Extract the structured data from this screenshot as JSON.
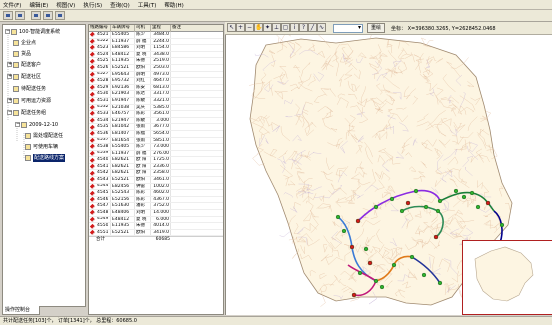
{
  "menu": [
    "文件(F)",
    "编辑(E)",
    "视图(V)",
    "执行(S)",
    "查询(Q)",
    "工具(T)",
    "帮助(H)"
  ],
  "map_toolbar": {
    "tool_icons": [
      "arrow-select-icon",
      "zoom-in-icon",
      "zoom-out-icon",
      "pan-icon",
      "identify-icon",
      "measure-icon",
      "select-icon",
      "info-icon",
      "query-icon",
      "line-tool-icon",
      "curve-tool-icon",
      "polygon-tool-icon"
    ],
    "layer_select_value": "",
    "reset_label": "重绘",
    "coords_label": "坐标： X=396380.3265, Y=2628452.0468"
  },
  "tree": {
    "items": [
      {
        "label": "100·智能调度系统",
        "level": 0
      },
      {
        "label": "企业点",
        "level": 1
      },
      {
        "label": "货品",
        "level": 1
      },
      {
        "label": "配送客户",
        "level": 1
      },
      {
        "label": "配送社区",
        "level": 1
      },
      {
        "label": "待配送任务",
        "level": 1
      },
      {
        "label": "可用运力资源",
        "level": 1
      },
      {
        "label": "配送任务组",
        "level": 1
      },
      {
        "label": "2009-12-10",
        "level": 2
      },
      {
        "label": "需处理配送任",
        "level": 3
      },
      {
        "label": "可使用车辆",
        "level": 3
      },
      {
        "label": "配送路线方案",
        "level": 3
      }
    ],
    "panel_tab": "操作控制台"
  },
  "grid": {
    "columns": [
      "线路编号",
      "车辆牌号",
      "司机",
      "里程",
      "备注"
    ],
    "rows": [
      [
        "4521",
        "E55405",
        "陈少",
        "3484.0",
        ""
      ],
      [
        "4522",
        "E11937",
        "薛 福",
        "2244.0",
        ""
      ],
      [
        "4523",
        "E84586",
        "刘明",
        "1154.0",
        ""
      ],
      [
        "4524",
        "E48412",
        "夏 晓",
        "3438.0",
        ""
      ],
      [
        "4525",
        "E11935",
        "朱德",
        "2519.0",
        ""
      ],
      [
        "4526",
        "E52521",
        "欧阳",
        "2503.0",
        ""
      ],
      [
        "4527",
        "E95643",
        "薛明",
        "4973.0",
        ""
      ],
      [
        "4528",
        "E95732",
        "刘红",
        "4647.0",
        ""
      ],
      [
        "4529",
        "E92136",
        "陈安",
        "6813.0",
        ""
      ],
      [
        "4530",
        "E21903",
        "陈达",
        "3317.0",
        ""
      ],
      [
        "4531",
        "E91947",
        "陈敏",
        "3321.0",
        ""
      ],
      [
        "4532",
        "E21038",
        "吴庆",
        "5385.0",
        ""
      ],
      [
        "4533",
        "E46757",
        "陈彩",
        "3561.0",
        ""
      ],
      [
        "4534",
        "E21947",
        "陈敏",
        "3.000",
        ""
      ],
      [
        "4535",
        "E81042",
        "张雨",
        "3677.0",
        ""
      ],
      [
        "4536",
        "E81407",
        "陈福",
        "5654.0",
        ""
      ],
      [
        "4537",
        "E81654",
        "张雨",
        "5851.0",
        ""
      ],
      [
        "4538",
        "E55405",
        "陈少",
        "73.000",
        ""
      ],
      [
        "4539",
        "E11937",
        "薛 福",
        "276.00",
        ""
      ],
      [
        "4540",
        "E82621",
        "欧 阳",
        "1725.0",
        ""
      ],
      [
        "4541",
        "E82621",
        "欧 阳",
        "2336.0",
        ""
      ],
      [
        "4542",
        "E82621",
        "欧 阳",
        "2358.0",
        ""
      ],
      [
        "4543",
        "E52521",
        "欧阳",
        "3461.0",
        ""
      ],
      [
        "4544",
        "E82456",
        "钟雷",
        "1002.0",
        ""
      ],
      [
        "4545",
        "E52543",
        "陈彩",
        "4602.0",
        ""
      ],
      [
        "4546",
        "E52156",
        "陈彩",
        "4367.0",
        ""
      ],
      [
        "4547",
        "E51630",
        "潘彩",
        "3752.0",
        ""
      ],
      [
        "4548",
        "E48406",
        "刘明",
        "14.000",
        ""
      ],
      [
        "4549",
        "E48412",
        "夏 晓",
        "6.000",
        ""
      ],
      [
        "4550",
        "E11935",
        "朱德",
        "4014.0",
        ""
      ],
      [
        "4551",
        "E52521",
        "欧阳",
        "3419.0",
        ""
      ]
    ],
    "total_label": "合计",
    "total_value": "60685"
  },
  "status": "共计配送任务[103]个， 订单[1341]个， 总里程：60685.0",
  "colors": {
    "window_bg": "#d4d0c8",
    "map_bg": "#fff8e8",
    "region_fill": "#fdf5e2",
    "road_color": "#e2bfa0",
    "selection_bg": "#0a246a",
    "node_red": "#d21a1a",
    "node_green": "#2fb22f",
    "overview_border": "#b02020"
  },
  "route_colors": [
    "#8a2be2",
    "#1a7f3a",
    "#00008b",
    "#2e8b57",
    "#3a7ad6",
    "#e07a1a",
    "#c0197a",
    "#223399"
  ]
}
